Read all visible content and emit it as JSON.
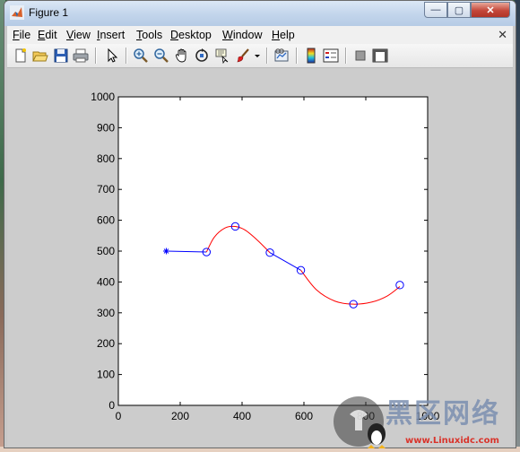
{
  "window": {
    "title": "Figure 1",
    "controls": {
      "minimize": "—",
      "maximize": "▢",
      "close": "✕"
    }
  },
  "menubar": {
    "items": [
      "File",
      "Edit",
      "View",
      "Insert",
      "Tools",
      "Desktop",
      "Window",
      "Help"
    ],
    "close_glyph": "✕"
  },
  "toolbar": {
    "icons": [
      "new-figure-icon",
      "open-file-icon",
      "save-icon",
      "print-icon",
      "pointer-icon",
      "zoom-in-icon",
      "zoom-out-icon",
      "pan-hand-icon",
      "rotate-3d-icon",
      "data-cursor-icon",
      "brush-icon",
      "brush-dropdown-icon",
      "link-plot-icon",
      "colorbar-icon",
      "legend-icon",
      "hide-plot-tools-icon",
      "show-plot-tools-icon"
    ]
  },
  "chart_data": {
    "type": "line",
    "title": "",
    "xlabel": "",
    "ylabel": "",
    "xlim": [
      0,
      1000
    ],
    "ylim": [
      0,
      1000
    ],
    "xticks": [
      "0",
      "200",
      "400",
      "600",
      "800",
      "1000"
    ],
    "yticks": [
      "0",
      "100",
      "200",
      "300",
      "400",
      "500",
      "600",
      "700",
      "800",
      "900",
      "1000"
    ],
    "grid": false,
    "colors": {
      "blue": "#0000ff",
      "red": "#ff0000"
    },
    "series": [
      {
        "role": "start-marker",
        "color": "blue",
        "marker": "star",
        "points": [
          [
            155,
            500
          ]
        ]
      },
      {
        "role": "blue-segment-1",
        "color": "blue",
        "marker": "circle",
        "points": [
          [
            155,
            500
          ],
          [
            285,
            497
          ]
        ]
      },
      {
        "role": "red-arc-1",
        "color": "red",
        "marker": "none",
        "points": [
          [
            285,
            497
          ],
          [
            310,
            545
          ],
          [
            345,
            575
          ],
          [
            378,
            580
          ],
          [
            410,
            568
          ],
          [
            450,
            535
          ],
          [
            490,
            495
          ]
        ]
      },
      {
        "role": "blue-segment-2",
        "color": "blue",
        "marker": "circle",
        "points": [
          [
            490,
            495
          ],
          [
            590,
            438
          ]
        ]
      },
      {
        "role": "red-arc-2",
        "color": "red",
        "marker": "none",
        "points": [
          [
            590,
            438
          ],
          [
            640,
            375
          ],
          [
            700,
            338
          ],
          [
            760,
            328
          ],
          [
            820,
            335
          ],
          [
            870,
            355
          ],
          [
            910,
            385
          ]
        ]
      }
    ],
    "circle_markers": [
      [
        285,
        497
      ],
      [
        378,
        580
      ],
      [
        490,
        495
      ],
      [
        590,
        438
      ],
      [
        760,
        328
      ],
      [
        910,
        390
      ]
    ]
  },
  "watermark": {
    "chinese": "黑区网络",
    "url": "www.Linuxidc.com"
  }
}
